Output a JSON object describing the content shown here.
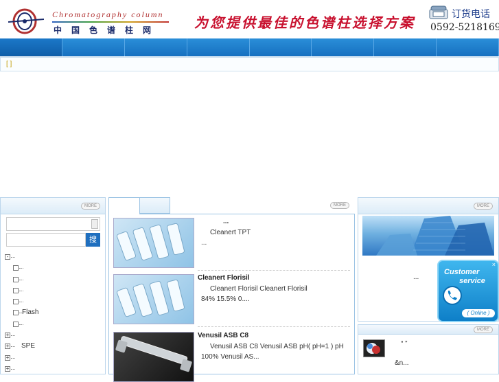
{
  "header": {
    "logo_en": "Chromatography column",
    "logo_cn": "中国色谱柱网",
    "slogan": "为您提供最佳的色谱柱选择方案",
    "phone_label": "订货电话",
    "phone_number": "0592-5218169"
  },
  "nav": {
    "items": [
      "",
      "",
      "",
      "",
      "",
      "",
      "",
      ""
    ]
  },
  "notice": {
    "text": "[ ]"
  },
  "more_label": "MORE",
  "search": {
    "button": "搜"
  },
  "tree": [
    {
      "expand": "-",
      "indent": 0,
      "label": ""
    },
    {
      "expand": "",
      "indent": 1,
      "label": ""
    },
    {
      "expand": "",
      "indent": 1,
      "label": ""
    },
    {
      "expand": "",
      "indent": 1,
      "label": ""
    },
    {
      "expand": "",
      "indent": 1,
      "label": ""
    },
    {
      "expand": "",
      "indent": 1,
      "label": "Flash"
    },
    {
      "expand": "",
      "indent": 1,
      "label": ""
    },
    {
      "expand": "+",
      "indent": 0,
      "label": ""
    },
    {
      "expand": "+",
      "indent": 0,
      "label": "SPE"
    },
    {
      "expand": "+",
      "indent": 0,
      "label": ""
    },
    {
      "expand": "+",
      "indent": 0,
      "label": ""
    }
  ],
  "products": [
    {
      "title": "...",
      "desc1": "Cleanert TPT",
      "desc2": "    ..."
    },
    {
      "title": "Cleanert Florisil",
      "desc1": "Cleanert Florisil Cleanert Florisil",
      "desc2": "84%      15.5%      0...."
    },
    {
      "title": "Venusil ASB C8",
      "desc1": "Venusil ASB C8 Venusil ASB      pH( pH=1 )  pH",
      "desc2": "         100%      Venusil AS..."
    }
  ],
  "right": {
    "ellipsis": "...",
    "news_quote": "“  ”",
    "news_text": "&n..."
  },
  "customer_service": {
    "line1": "Customer",
    "line2": "service",
    "online": "( Online )",
    "close": "×"
  }
}
